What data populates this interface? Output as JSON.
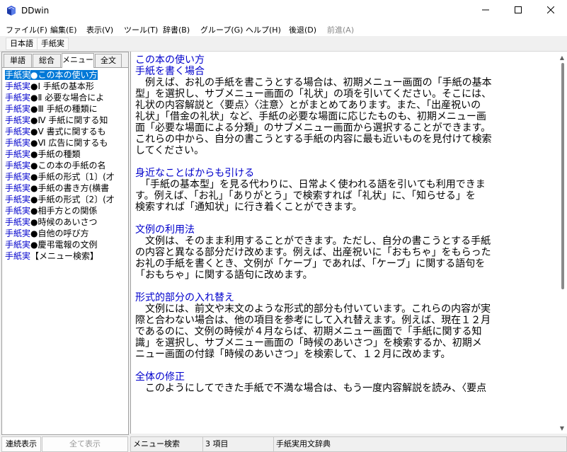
{
  "window": {
    "title": "DDwin"
  },
  "menu": [
    {
      "label": "ファイル(F)",
      "disabled": false
    },
    {
      "label": "編集(E)",
      "disabled": false
    },
    {
      "label": "表示(V)",
      "disabled": false
    },
    {
      "label": "ツール(T)",
      "disabled": false
    },
    {
      "label": "辞書(B)",
      "disabled": false
    },
    {
      "label": "グループ(G)",
      "disabled": false
    },
    {
      "label": "ヘルプ(H)",
      "disabled": false
    },
    {
      "label": "後退(D)",
      "disabled": false
    },
    {
      "label": "前進(A)",
      "disabled": true
    }
  ],
  "languages": [
    "日本語",
    "手紙実"
  ],
  "tabs": [
    {
      "label": "単語",
      "active": false
    },
    {
      "label": "総合",
      "active": false
    },
    {
      "label": "メニュー",
      "active": true
    },
    {
      "label": "全文",
      "active": false
    }
  ],
  "list": [
    {
      "prefix": "手紙実",
      "text": "●この本の使い方",
      "selected": true
    },
    {
      "prefix": "手紙実",
      "text": "●Ⅰ 手紙の基本形",
      "selected": false
    },
    {
      "prefix": "手紙実",
      "text": "●Ⅱ 必要な場合によ",
      "selected": false
    },
    {
      "prefix": "手紙実",
      "text": "●Ⅲ 手紙の種類に",
      "selected": false
    },
    {
      "prefix": "手紙実",
      "text": "●Ⅳ 手紙に関する知",
      "selected": false
    },
    {
      "prefix": "手紙実",
      "text": "●Ⅴ 書式に関するも",
      "selected": false
    },
    {
      "prefix": "手紙実",
      "text": "●Ⅵ 広告に関するも",
      "selected": false
    },
    {
      "prefix": "手紙実",
      "text": "●手紙の種類",
      "selected": false
    },
    {
      "prefix": "手紙実",
      "text": "●この本の手紙の名",
      "selected": false
    },
    {
      "prefix": "手紙実",
      "text": "●手紙の形式〔1〕(才",
      "selected": false
    },
    {
      "prefix": "手紙実",
      "text": "●手紙の書き方(横書",
      "selected": false
    },
    {
      "prefix": "手紙実",
      "text": "●手紙の形式〔2〕(才",
      "selected": false
    },
    {
      "prefix": "手紙実",
      "text": "●相手方との関係",
      "selected": false
    },
    {
      "prefix": "手紙実",
      "text": "●時候のあいさつ",
      "selected": false
    },
    {
      "prefix": "手紙実",
      "text": "●自他の呼び方",
      "selected": false
    },
    {
      "prefix": "手紙実",
      "text": "●慶弔電報の文例",
      "selected": false
    },
    {
      "prefix": "手紙実",
      "text": "【メニュー検索】",
      "selected": false
    }
  ],
  "content": [
    {
      "type": "heading",
      "text": "この本の使い方"
    },
    {
      "type": "heading",
      "text": "手紙を書く場合"
    },
    {
      "type": "para",
      "lines": [
        "　例えば、お礼の手紙を書こうとする場合は、初期メニュー画面の「手紙の基本",
        "型」を選択し、サブメニュー画面の「礼状」の項を引いてください。そこには、",
        "礼状の内容解説と〈要点〉〈注意〉とがまとめてあります。また、「出産祝いの",
        "礼状」「借金の礼状」など、手紙の必要な場面に応じたものも、初期メニュー画",
        "面「必要な場面による分類」のサブメニュー画面から選択することができます。",
        "これらの中から、自分の書こうとする手紙の内容に最も近いものを見付けて検索",
        "してください。"
      ]
    },
    {
      "type": "gap"
    },
    {
      "type": "heading",
      "text": "身近なことばからも引ける"
    },
    {
      "type": "para",
      "lines": [
        "　「手紙の基本型」を見る代わりに、日常よく使われる語を引いても利用できま",
        "す。例えば、「お礼」「ありがとう」で検索すれば「礼状」に、「知らせる」を",
        "検索すれば「通知状」に行き着くことができます。"
      ]
    },
    {
      "type": "gap"
    },
    {
      "type": "heading",
      "text": "文例の利用法"
    },
    {
      "type": "para",
      "lines": [
        "　文例は、そのまま利用することができます。ただし、自分の書こうとする手紙",
        "の内容と異なる部分だけ改めます。例えば、出産祝いに「おもちゃ」をもらった",
        "お礼の手紙を書くとき、文例が「ケーブ」であれば、「ケーブ」に関する語句を",
        "「おもちゃ」に関する語句に改めます。"
      ]
    },
    {
      "type": "gap"
    },
    {
      "type": "heading",
      "text": "形式的部分の入れ替え"
    },
    {
      "type": "para",
      "lines": [
        "　文例には、前文や末文のような形式的部分も付いています。これらの内容が実",
        "際と合わない場合は、他の項目を参考にして入れ替えます。例えば、現在１２月",
        "であるのに、文例の時候が４月ならば、初期メニュー画面で「手紙に関する知",
        "識」を選択し、サブメニュー画面の「時候のあいさつ」を検索するか、初期メ",
        "ニュー画面の付録「時候のあいさつ」を検索して、１２月に改めます。"
      ]
    },
    {
      "type": "gap"
    },
    {
      "type": "heading",
      "text": "全体の修正"
    },
    {
      "type": "para",
      "lines": [
        "　このようにしてできた手紙で不満な場合は、もう一度内容解説を読み、〈要点"
      ]
    }
  ],
  "buttons": {
    "continuous": "連続表示",
    "show_all": "全て表示"
  },
  "status": {
    "mode": "メニュー検索",
    "count": "3 項目",
    "dictionary": "手紙実用文辞典"
  }
}
